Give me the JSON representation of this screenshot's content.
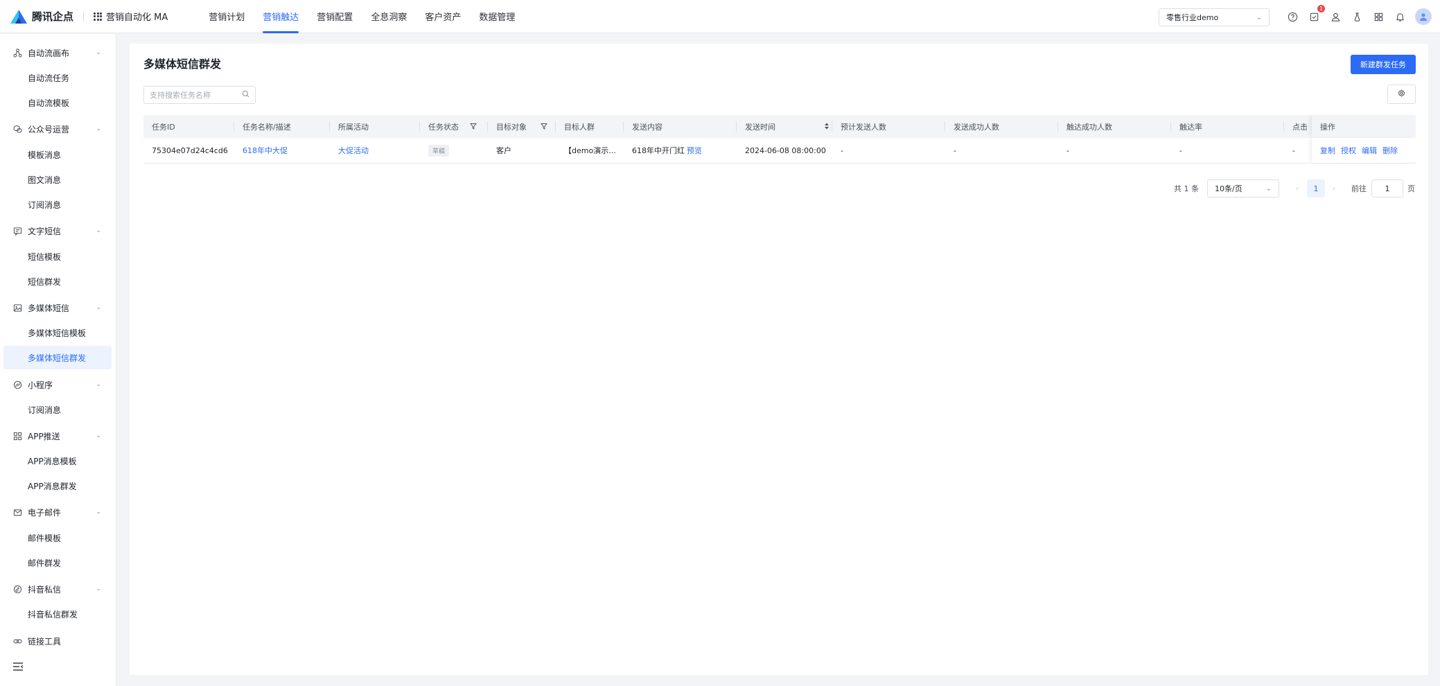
{
  "topbar": {
    "logo_text": "腾讯企点",
    "product_name": "营销自动化 MA",
    "nav": [
      "营销计划",
      "营销触达",
      "营销配置",
      "全息洞察",
      "客户资产",
      "数据管理"
    ],
    "active_nav": "营销触达",
    "tenant": "零售行业demo",
    "notification_badge": "1",
    "icons": [
      "help-icon",
      "task-icon",
      "user-icon",
      "flask-icon",
      "apps-icon",
      "bell-icon",
      "avatar"
    ]
  },
  "sidebar": {
    "groups": [
      {
        "label": "自动流画布",
        "icon": "flow-icon",
        "items": [
          "自动流任务",
          "自动流模板"
        ]
      },
      {
        "label": "公众号运营",
        "icon": "wechat-icon",
        "items": [
          "模板消息",
          "图文消息",
          "订阅消息"
        ]
      },
      {
        "label": "文字短信",
        "icon": "message-icon",
        "items": [
          "短信模板",
          "短信群发"
        ]
      },
      {
        "label": "多媒体短信",
        "icon": "image-message-icon",
        "items": [
          "多媒体短信模板",
          "多媒体短信群发"
        ]
      },
      {
        "label": "小程序",
        "icon": "miniprogram-icon",
        "items": [
          "订阅消息"
        ]
      },
      {
        "label": "APP推送",
        "icon": "grid-icon",
        "items": [
          "APP消息模板",
          "APP消息群发"
        ]
      },
      {
        "label": "电子邮件",
        "icon": "mail-icon",
        "items": [
          "邮件模板",
          "邮件群发"
        ]
      },
      {
        "label": "抖音私信",
        "icon": "douyin-icon",
        "items": [
          "抖音私信群发"
        ]
      },
      {
        "label": "链接工具",
        "icon": "link-icon",
        "items": []
      }
    ],
    "active_item": "多媒体短信群发"
  },
  "main": {
    "title": "多媒体短信群发",
    "new_button": "新建群发任务",
    "search_placeholder": "支持搜索任务名称",
    "columns": [
      "任务ID",
      "任务名称/描述",
      "所属活动",
      "任务状态",
      "目标对象",
      "目标人群",
      "发送内容",
      "发送时间",
      "预计发送人数",
      "发送成功人数",
      "触达成功人数",
      "触达率",
      "点击",
      "操作"
    ],
    "rows": [
      {
        "id": "75304e07d24c4cd6",
        "name": "618年中大促",
        "activity": "大促活动",
        "status": "草稿",
        "target": "客户",
        "audience": "【demo演示...",
        "content": "618年中开门红",
        "preview": "预览",
        "send_time": "2024-06-08 08:00:00",
        "expected": "-",
        "sent_ok": "-",
        "reach_ok": "-",
        "reach_rate": "-",
        "clicks": "-",
        "ops": [
          "复制",
          "授权",
          "编辑",
          "删除"
        ]
      }
    ]
  },
  "pagination": {
    "total": "共 1 条",
    "page_size": "10条/页",
    "current": "1",
    "goto_label": "前往",
    "goto_value": "1",
    "page_suffix": "页"
  },
  "colors": {
    "primary": "#2b6bf6",
    "badge": "#e5484d"
  }
}
